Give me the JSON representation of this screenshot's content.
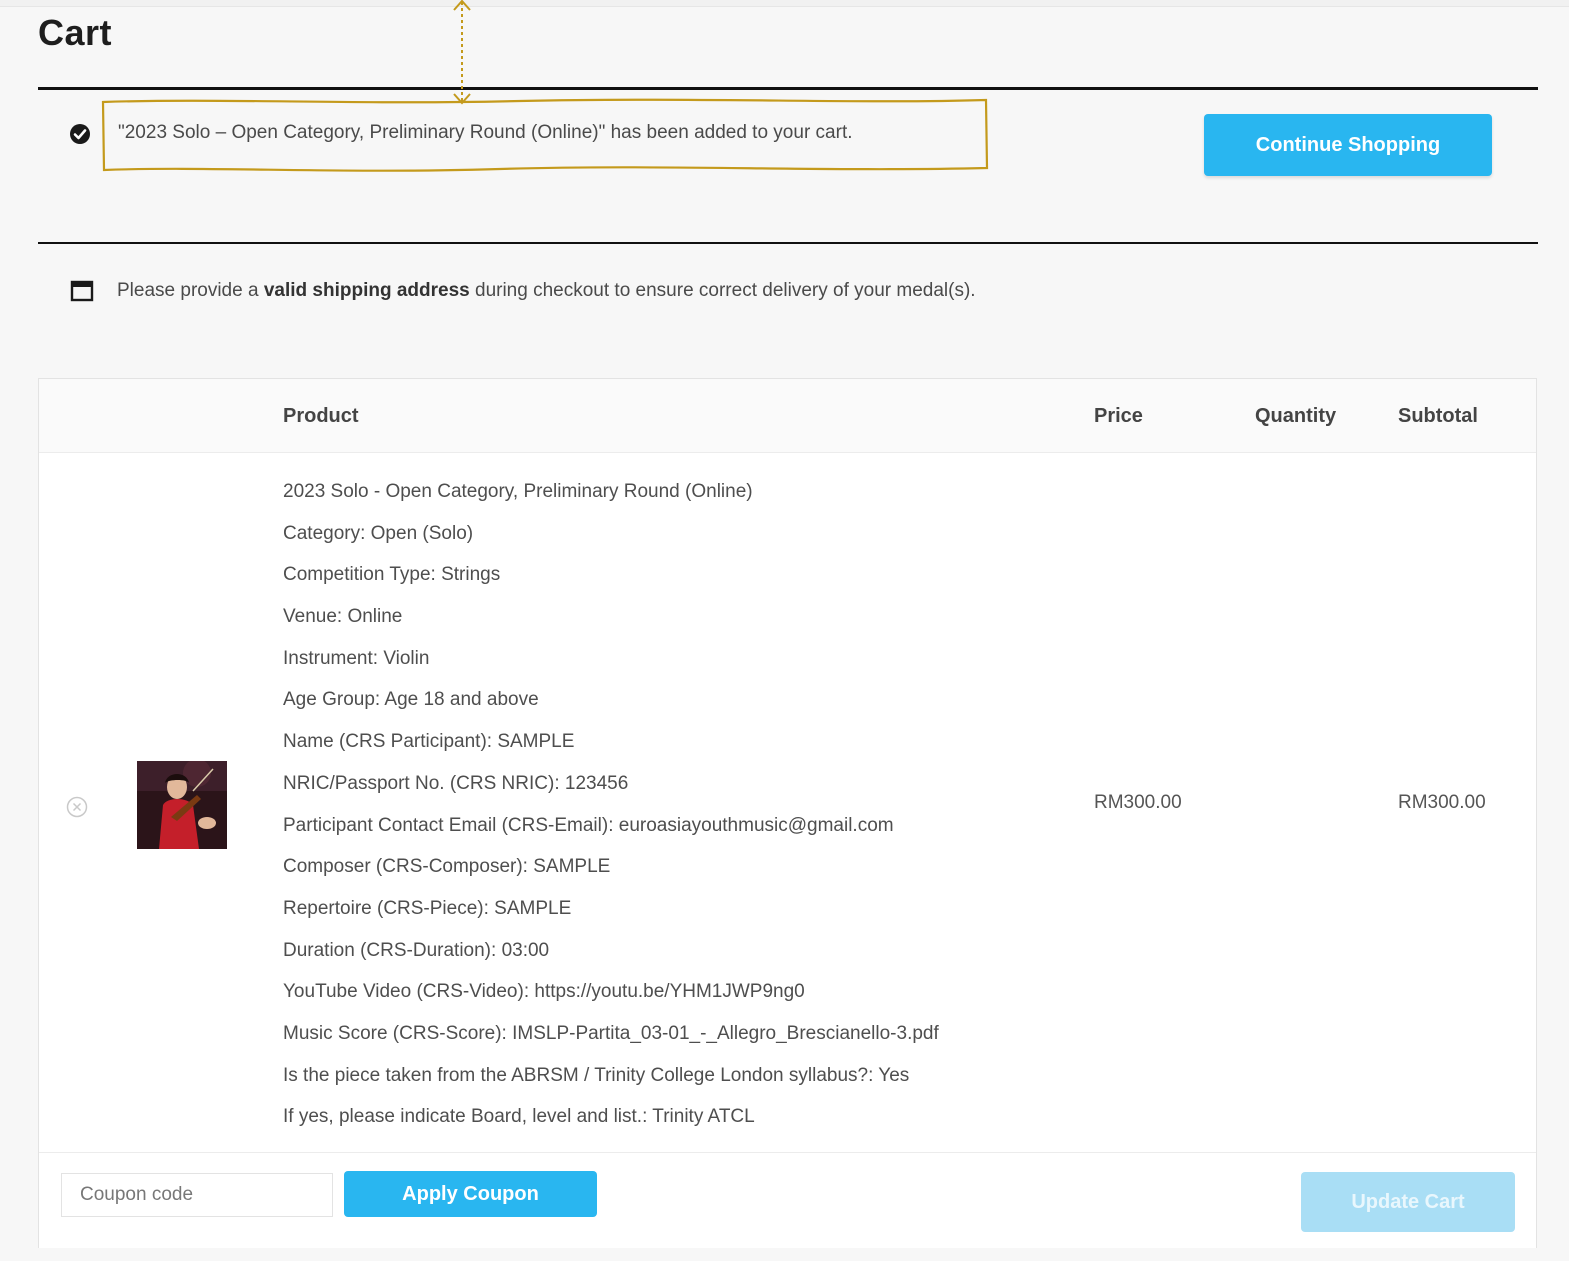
{
  "page": {
    "title": "Cart"
  },
  "notice": {
    "message": "\"2023 Solo – Open Category, Preliminary Round (Online)\" has been added to your cart.",
    "continue_label": "Continue Shopping"
  },
  "shipping_info": {
    "prefix": "Please provide a ",
    "bold": "valid shipping address",
    "suffix": " during checkout to ensure correct delivery of your medal(s)."
  },
  "table": {
    "headers": {
      "product": "Product",
      "price": "Price",
      "quantity": "Quantity",
      "subtotal": "Subtotal"
    },
    "item": {
      "title": "2023 Solo - Open Category, Preliminary Round (Online)",
      "meta": [
        "Category: Open (Solo)",
        "Competition Type: Strings",
        "Venue: Online",
        "Instrument: Violin",
        "Age Group: Age 18 and above",
        "Name (CRS Participant): SAMPLE",
        "NRIC/Passport No. (CRS NRIC): 123456",
        "Participant Contact Email (CRS-Email): euroasiayouthmusic@gmail.com",
        "Composer (CRS-Composer): SAMPLE",
        "Repertoire (CRS-Piece): SAMPLE",
        "Duration (CRS-Duration): 03:00",
        "YouTube Video (CRS-Video): https://youtu.be/YHM1JWP9ng0",
        "Music Score (CRS-Score): IMSLP-Partita_03-01_-_Allegro_Brescianello-3.pdf",
        "Is the piece taken from the ABRSM / Trinity College London syllabus?: Yes",
        "If yes, please indicate Board, level and list.: Trinity ATCL"
      ],
      "price": "RM300.00",
      "subtotal": "RM300.00"
    }
  },
  "actions": {
    "coupon_placeholder": "Coupon code",
    "apply_label": "Apply Coupon",
    "update_label": "Update Cart"
  },
  "colors": {
    "accent": "#29b6f0",
    "accent_disabled": "#a9def5",
    "annotation": "#c49a1c"
  }
}
